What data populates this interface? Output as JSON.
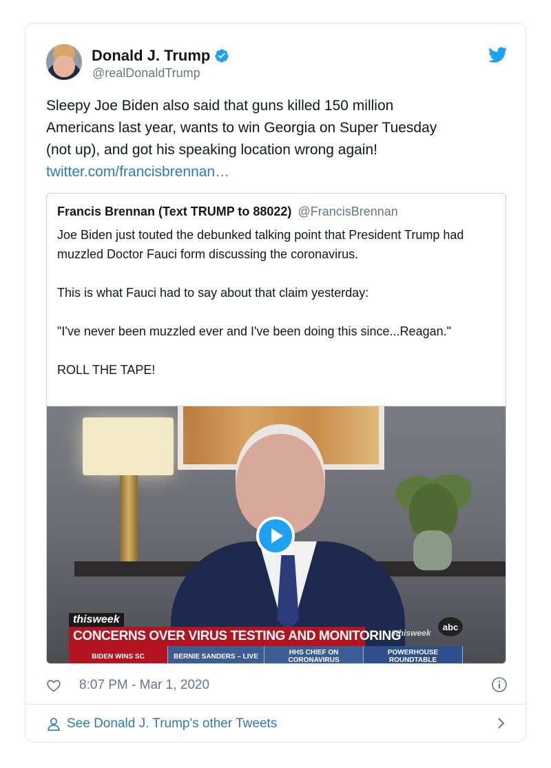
{
  "tweet": {
    "author_name": "Donald J. Trump",
    "author_handle": "@realDonaldTrump",
    "text_lines": [
      "Sleepy Joe Biden also said that guns killed 150 million",
      "Americans last year, wants to win Georgia on Super Tuesday",
      "(not up), and got his speaking location wrong again!"
    ],
    "link": "twitter.com/francisbrennan…",
    "timestamp": "8:07 PM - Mar 1, 2020"
  },
  "quoted_tweet": {
    "author_name": "Francis Brennan (Text TRUMP to 88022)",
    "author_handle": "@FrancisBrennan",
    "paragraphs": [
      "Joe Biden just touted the debunked talking point that President Trump had muzzled Doctor Fauci form discussing the coronavirus.",
      "This is what Fauci had to say about that claim yesterday:",
      "\"I've never been muzzled ever and I've been doing this since...Reagan.\"",
      "ROLL THE TAPE!"
    ]
  },
  "video": {
    "brand": "thisweek",
    "headline": "CONCERNS OVER VIRUS TESTING AND MONITORING",
    "ticker": [
      "BIDEN WINS SC",
      "BERNIE SANDERS – LIVE",
      "HHS CHIEF ON CORONAVIRUS",
      "POWERHOUSE ROUNDTABLE"
    ],
    "hashtag": "#thisweek",
    "network": "abc"
  },
  "see_more_label": "See Donald J. Trump's other Tweets",
  "colors": {
    "link": "#2b7bb9",
    "twitter_blue": "#1da1f2",
    "muted": "#657786",
    "border": "#e1e8ed"
  },
  "icons": [
    "verified-badge-icon",
    "twitter-bird-icon",
    "play-icon",
    "heart-icon",
    "info-icon",
    "person-icon",
    "chevron-right-icon"
  ]
}
